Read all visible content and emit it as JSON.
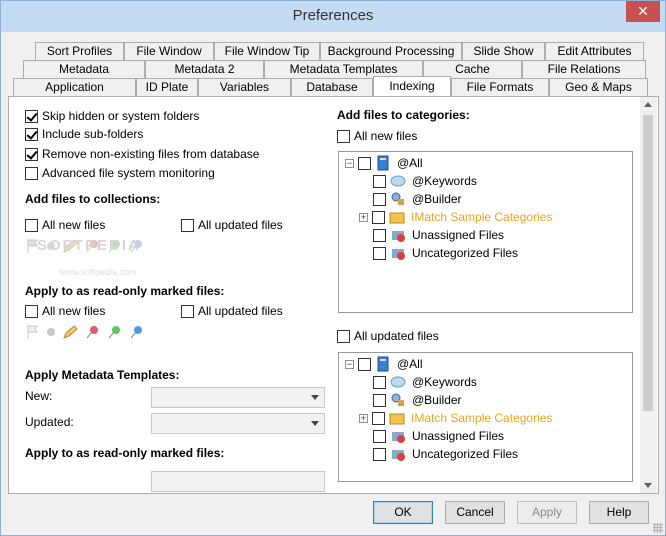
{
  "window": {
    "title": "Preferences",
    "close": "✕"
  },
  "tabs": {
    "row1": [
      "Sort Profiles",
      "File Window",
      "File Window Tip",
      "Background Processing",
      "Slide Show",
      "Edit Attributes"
    ],
    "row2": [
      "Metadata",
      "Metadata 2",
      "Metadata Templates",
      "Cache",
      "File Relations"
    ],
    "row3": [
      "Application",
      "ID Plate",
      "Variables",
      "Database",
      "Indexing",
      "File Formats",
      "Geo & Maps"
    ],
    "active": "Indexing"
  },
  "left": {
    "options": [
      {
        "label": "Skip hidden or system folders",
        "checked": true
      },
      {
        "label": "Include sub-folders",
        "checked": true
      },
      {
        "label": "Remove non-existing files from database",
        "checked": true
      },
      {
        "label": "Advanced file system monitoring",
        "checked": false
      }
    ],
    "collections": {
      "heading": "Add files to collections:",
      "all_new": "All new files",
      "all_updated": "All updated files"
    },
    "readonly": {
      "heading": "Apply to as read-only marked files:",
      "all_new": "All new files",
      "all_updated": "All updated files"
    },
    "templates": {
      "heading": "Apply Metadata Templates:",
      "new_label": "New:",
      "updated_label": "Updated:"
    },
    "readonly2": {
      "heading": "Apply to as read-only marked files:"
    }
  },
  "right": {
    "heading": "Add files to categories:",
    "all_new": "All new files",
    "all_updated": "All updated files",
    "tree": [
      {
        "label": "@All",
        "level": 0,
        "color": "#000000"
      },
      {
        "label": "@Keywords",
        "level": 1,
        "color": "#000000"
      },
      {
        "label": "@Builder",
        "level": 1,
        "color": "#000000"
      },
      {
        "label": "IMatch Sample Categories",
        "level": 1,
        "color": "#e8a51c"
      },
      {
        "label": "Unassigned Files",
        "level": 1,
        "color": "#000000"
      },
      {
        "label": "Uncategorized Files",
        "level": 1,
        "color": "#000000"
      }
    ]
  },
  "watermark": {
    "brand": "SOFTPEDIA",
    "url": "www.softpedia.com"
  },
  "buttons": {
    "ok": "OK",
    "cancel": "Cancel",
    "apply": "Apply",
    "help": "Help"
  }
}
